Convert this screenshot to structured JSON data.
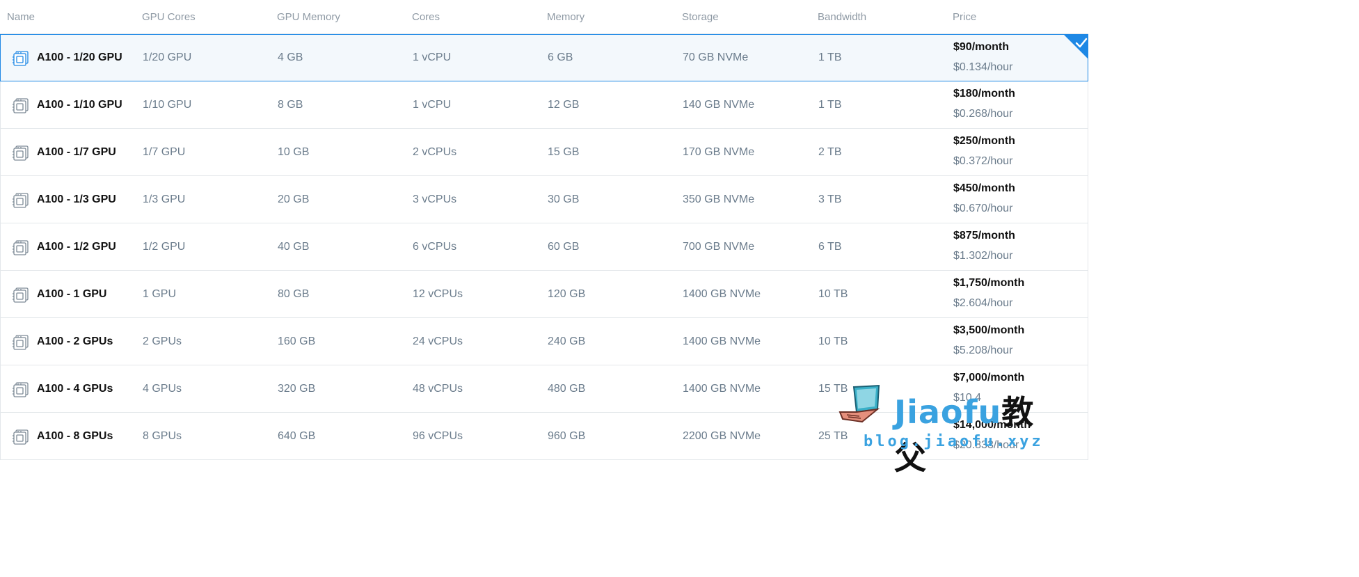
{
  "headers": {
    "name": "Name",
    "gpu_cores": "GPU Cores",
    "gpu_memory": "GPU Memory",
    "cores": "Cores",
    "memory": "Memory",
    "storage": "Storage",
    "bandwidth": "Bandwidth",
    "price": "Price"
  },
  "rows": [
    {
      "name": "A100 - 1/20 GPU",
      "gpu_cores": "1/20 GPU",
      "gpu_memory": "4 GB",
      "cores": "1 vCPU",
      "memory": "6 GB",
      "storage": "70 GB NVMe",
      "bandwidth": "1 TB",
      "price_month": "$90/month",
      "price_hour": "$0.134/hour",
      "selected": true
    },
    {
      "name": "A100 - 1/10 GPU",
      "gpu_cores": "1/10 GPU",
      "gpu_memory": "8 GB",
      "cores": "1 vCPU",
      "memory": "12 GB",
      "storage": "140 GB NVMe",
      "bandwidth": "1 TB",
      "price_month": "$180/month",
      "price_hour": "$0.268/hour",
      "selected": false
    },
    {
      "name": "A100 - 1/7 GPU",
      "gpu_cores": "1/7 GPU",
      "gpu_memory": "10 GB",
      "cores": "2 vCPUs",
      "memory": "15 GB",
      "storage": "170 GB NVMe",
      "bandwidth": "2 TB",
      "price_month": "$250/month",
      "price_hour": "$0.372/hour",
      "selected": false
    },
    {
      "name": "A100 - 1/3 GPU",
      "gpu_cores": "1/3 GPU",
      "gpu_memory": "20 GB",
      "cores": "3 vCPUs",
      "memory": "30 GB",
      "storage": "350 GB NVMe",
      "bandwidth": "3 TB",
      "price_month": "$450/month",
      "price_hour": "$0.670/hour",
      "selected": false
    },
    {
      "name": "A100 - 1/2 GPU",
      "gpu_cores": "1/2 GPU",
      "gpu_memory": "40 GB",
      "cores": "6 vCPUs",
      "memory": "60 GB",
      "storage": "700 GB NVMe",
      "bandwidth": "6 TB",
      "price_month": "$875/month",
      "price_hour": "$1.302/hour",
      "selected": false
    },
    {
      "name": "A100 - 1 GPU",
      "gpu_cores": "1 GPU",
      "gpu_memory": "80 GB",
      "cores": "12 vCPUs",
      "memory": "120 GB",
      "storage": "1400 GB NVMe",
      "bandwidth": "10 TB",
      "price_month": "$1,750/month",
      "price_hour": "$2.604/hour",
      "selected": false
    },
    {
      "name": "A100 - 2 GPUs",
      "gpu_cores": "2 GPUs",
      "gpu_memory": "160 GB",
      "cores": "24 vCPUs",
      "memory": "240 GB",
      "storage": "1400 GB NVMe",
      "bandwidth": "10 TB",
      "price_month": "$3,500/month",
      "price_hour": "$5.208/hour",
      "selected": false
    },
    {
      "name": "A100 - 4 GPUs",
      "gpu_cores": "4 GPUs",
      "gpu_memory": "320 GB",
      "cores": "48 vCPUs",
      "memory": "480 GB",
      "storage": "1400 GB NVMe",
      "bandwidth": "15 TB",
      "price_month": "$7,000/month",
      "price_hour": "$10.4",
      "selected": false
    },
    {
      "name": "A100 - 8 GPUs",
      "gpu_cores": "8 GPUs",
      "gpu_memory": "640 GB",
      "cores": "96 vCPUs",
      "memory": "960 GB",
      "storage": "2200 GB NVMe",
      "bandwidth": "25 TB",
      "price_month": "$14,000/month",
      "price_hour": "$20.833/hour",
      "selected": false
    }
  ],
  "row_icon": "gpu-chip-icon",
  "selected_icon": "checkmark-icon",
  "colors": {
    "accent": "#1e88e5",
    "selected_bg": "#f3f8fc",
    "border": "#e3e7ea",
    "muted_text": "#6b7c8c",
    "strong_text": "#111111",
    "watermark_blue": "#3aa2e0"
  },
  "watermark": {
    "title_latin": "Jiaofu",
    "title_cn": "教父",
    "url": "blog.jiaofu.xyz"
  }
}
